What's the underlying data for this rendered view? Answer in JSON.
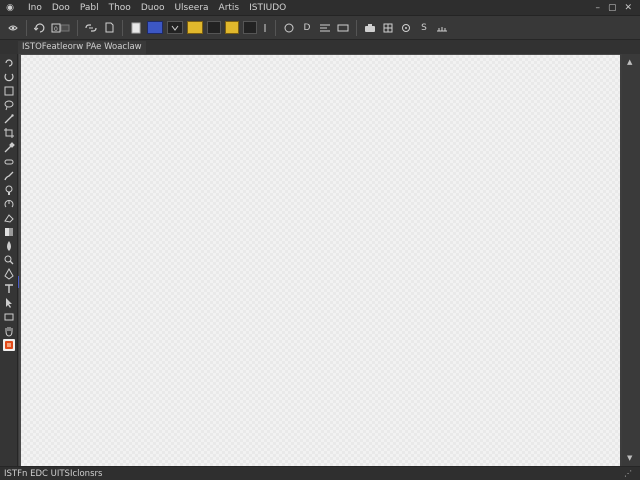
{
  "app": {
    "menu": [
      "Ino",
      "Doo",
      "Pabl",
      "Thoo",
      "Duoo",
      "Ulseera",
      "Artis",
      "ISTIUDO"
    ],
    "window_controls": [
      "–",
      "▢",
      "✕"
    ]
  },
  "optionsbar": {
    "labels": [
      "0",
      "D",
      "S"
    ]
  },
  "document": {
    "tab_title": "ISTOFeatleorw PAe Woaclaw"
  },
  "status": {
    "text": "ISTFn EDC UITSIclonsrs",
    "right": "⋰"
  },
  "colors": {
    "accent_blue": "#3c57c4",
    "accent_yellow": "#e1b82c",
    "active_tool": "#e24a1a"
  },
  "icons": {
    "app_logo": "eye-icon",
    "active_tool": "color-swatch-icon"
  }
}
